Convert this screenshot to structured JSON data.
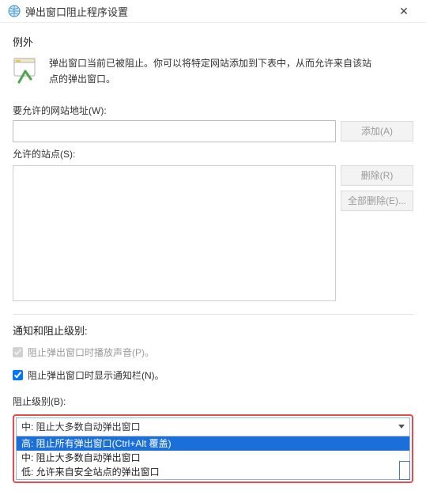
{
  "titlebar": {
    "title": "弹出窗口阻止程序设置"
  },
  "exception": {
    "heading": "例外",
    "intro_line1": "弹出窗口当前已被阻止。你可以将特定网站添加到下表中，从而允许来自该站",
    "intro_line2": "点的弹出窗口。",
    "allow_address_label": "要允许的网站地址(W):",
    "add_button": "添加(A)",
    "allowed_sites_label": "允许的站点(S):",
    "remove_button": "删除(R)",
    "remove_all_button": "全部删除(E)..."
  },
  "notification": {
    "heading": "通知和阻止级别:",
    "checkbox_sound": "阻止弹出窗口时播放声音(P)。",
    "checkbox_infobar": "阻止弹出窗口时显示通知栏(N)。",
    "level_label": "阻止级别(B):"
  },
  "dropdown": {
    "current": "中: 阻止大多数自动弹出窗口",
    "options": [
      "高: 阻止所有弹出窗口(Ctrl+Alt 覆盖)",
      "中: 阻止大多数自动弹出窗口",
      "低: 允许来自安全站点的弹出窗口"
    ]
  }
}
